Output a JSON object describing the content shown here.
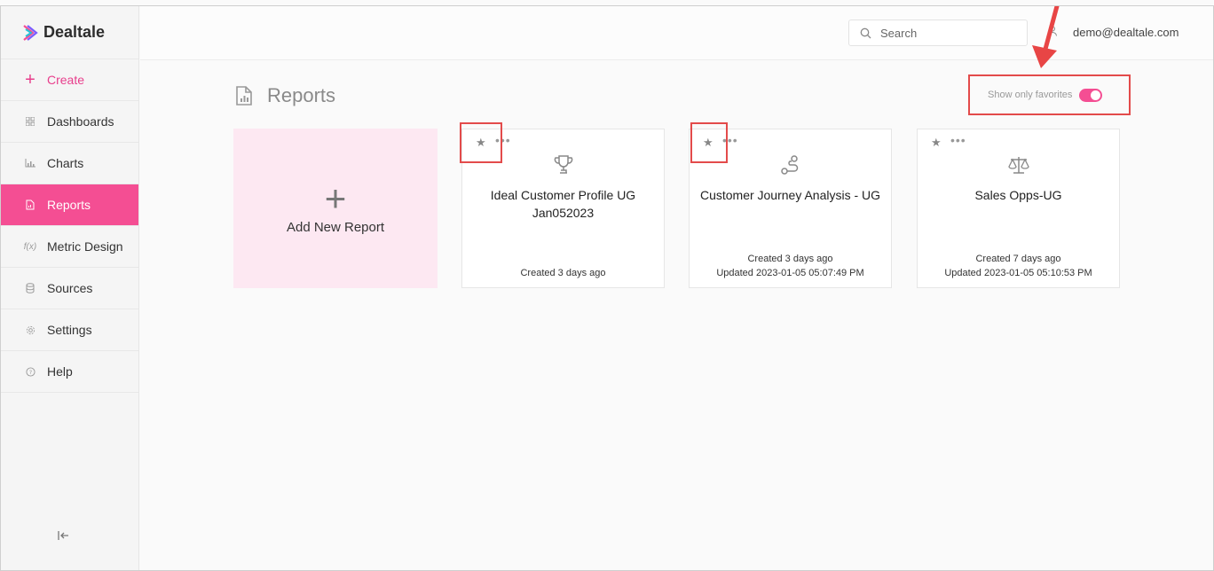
{
  "brand": {
    "name": "Dealtale",
    "accent": "#f44e93"
  },
  "sidebar": {
    "items": [
      {
        "label": "Create",
        "icon": "plus-icon"
      },
      {
        "label": "Dashboards",
        "icon": "grid-icon"
      },
      {
        "label": "Charts",
        "icon": "bar-chart-icon"
      },
      {
        "label": "Reports",
        "icon": "report-file-icon",
        "active": true
      },
      {
        "label": "Metric Design",
        "icon": "function-icon"
      },
      {
        "label": "Sources",
        "icon": "database-icon"
      },
      {
        "label": "Settings",
        "icon": "gear-icon"
      },
      {
        "label": "Help",
        "icon": "help-icon"
      }
    ],
    "collapse_icon": "collapse-left-icon"
  },
  "header": {
    "search_placeholder": "Search",
    "user_email": "demo@dealtale.com"
  },
  "page": {
    "title": "Reports",
    "favorites_label": "Show only favorites",
    "favorites_on": true,
    "add_report_label": "Add New Report"
  },
  "reports": [
    {
      "title": "Ideal Customer Profile UG Jan052023",
      "icon": "trophy-icon",
      "created": "Created 3 days ago",
      "updated": ""
    },
    {
      "title": "Customer Journey Analysis - UG",
      "icon": "route-icon",
      "created": "Created 3 days ago",
      "updated": "Updated 2023-01-05 05:07:49 PM"
    },
    {
      "title": "Sales Opps-UG",
      "icon": "scale-icon",
      "created": "Created 7 days ago",
      "updated": "Updated 2023-01-05 05:10:53 PM"
    }
  ],
  "dots_glyph": "•••",
  "star_glyph": "★"
}
